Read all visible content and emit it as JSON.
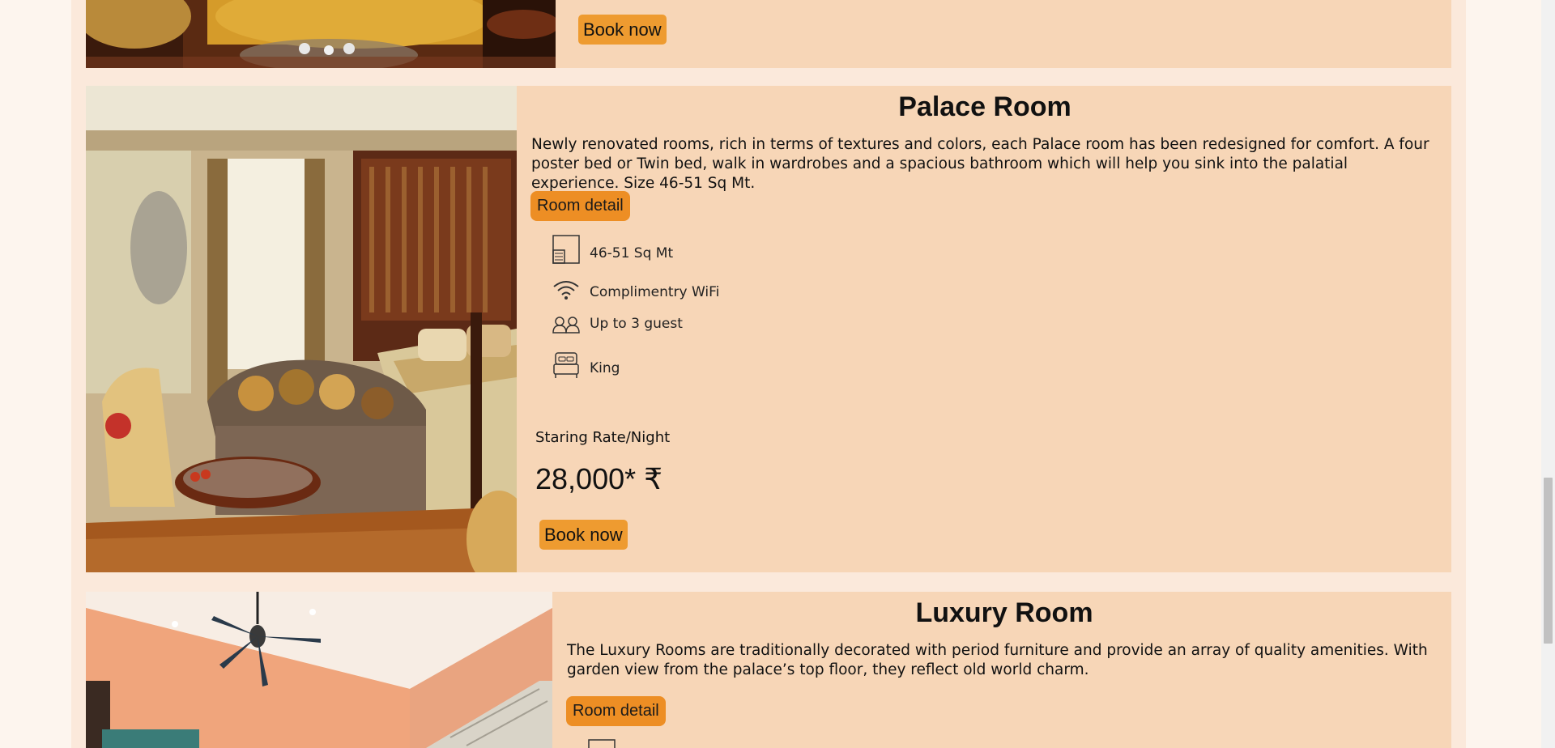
{
  "rooms": [
    {
      "book_label": "Book now"
    },
    {
      "title": "Palace Room",
      "description": "Newly renovated rooms, rich in terms of textures and colors, each Palace room has been redesigned for comfort. A four poster bed or Twin bed, walk in wardrobes and a spacious bathroom which will help you sink into the palatial experience. Size 46-51 Sq Mt.",
      "detail_label": "Room detail",
      "amenities": [
        {
          "icon": "floor-plan-icon",
          "label": "46-51 Sq Mt"
        },
        {
          "icon": "wifi-icon",
          "label": "Complimentry WiFi"
        },
        {
          "icon": "guests-icon",
          "label": "Up to 3 guest"
        },
        {
          "icon": "bed-icon",
          "label": "King"
        }
      ],
      "rate_label": "Staring Rate/Night",
      "price": "28,000* ₹",
      "book_label": "Book now"
    },
    {
      "title": "Luxury Room",
      "description": "The Luxury Rooms are traditionally decorated with period furniture and provide an array of quality amenities. With garden view from the palace’s top floor, they reflect old world charm.",
      "detail_label": "Room detail"
    }
  ],
  "colors": {
    "card_bg": "#f7d6b7",
    "detail_button": "#ed8e24",
    "book_button": "#ee9b30",
    "page_bg": "#fbe9db"
  }
}
